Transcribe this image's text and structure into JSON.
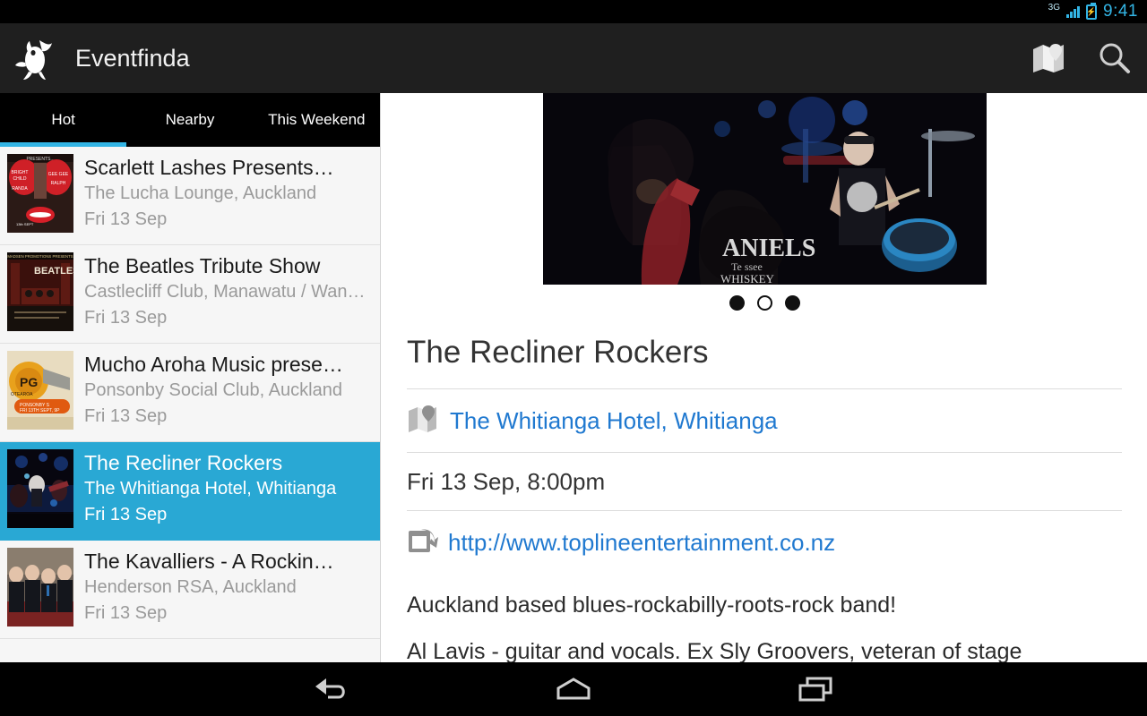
{
  "status_bar": {
    "network": "3G",
    "time": "9:41",
    "battery_icon": "battery-charging-icon",
    "signal_icon": "signal-bars-icon"
  },
  "action_bar": {
    "logo_icon": "eventfinda-bird-logo",
    "title": "Eventfinda",
    "map_icon": "map-icon",
    "search_icon": "search-icon"
  },
  "colors": {
    "accent": "#33b5e5",
    "selected_row": "#29a8d4",
    "link": "#2079d0",
    "action_bar": "#1f1f1f",
    "list_background": "#f6f6f6"
  },
  "tabs": {
    "items": [
      {
        "label": "Hot",
        "selected": true
      },
      {
        "label": "Nearby",
        "selected": false
      },
      {
        "label": "This Weekend",
        "selected": false
      }
    ]
  },
  "event_list": [
    {
      "title": "Scarlett Lashes Presents…",
      "venue": "The Lucha Lounge, Auckland",
      "date": "Fri 13 Sep",
      "selected": false,
      "thumb": "poster-red-lips"
    },
    {
      "title": "The Beatles Tribute Show",
      "venue": "Castlecliff Club, Manawatu / Wan…",
      "date": "Fri 13 Sep",
      "selected": false,
      "thumb": "poster-beatles-stage"
    },
    {
      "title": "Mucho Aroha Music prese…",
      "venue": "Ponsonby Social Club, Auckland",
      "date": "Fri 13 Sep",
      "selected": false,
      "thumb": "poster-orange-badge"
    },
    {
      "title": "The Recliner Rockers",
      "venue": "The Whitianga Hotel, Whitianga",
      "date": "Fri 13 Sep",
      "selected": true,
      "thumb": "photo-band-blue-stage"
    },
    {
      "title": "The Kavalliers - A Rockin…",
      "venue": "Henderson RSA, Auckland",
      "date": "Fri 13 Sep",
      "selected": false,
      "thumb": "photo-band-group"
    }
  ],
  "detail": {
    "carousel": {
      "image_alt": "band performing on stage with double bass and drums",
      "dots": [
        "filled",
        "current",
        "filled"
      ],
      "current_index": 1
    },
    "title": "The Recliner Rockers",
    "venue": {
      "icon": "map-icon",
      "label": "The Whitianga Hotel, Whitianga"
    },
    "datetime": "Fri 13 Sep,  8:00pm",
    "website": {
      "icon": "external-link-icon",
      "label": "http://www.toplineentertainment.co.nz"
    },
    "description": [
      "Auckland based blues-rockabilly-roots-rock band!",
      "Al Lavis - guitar and vocals. Ex Sly Groovers, veteran of stage"
    ]
  },
  "nav_bar": {
    "back_icon": "back-icon",
    "home_icon": "home-icon",
    "recents_icon": "recents-icon"
  }
}
